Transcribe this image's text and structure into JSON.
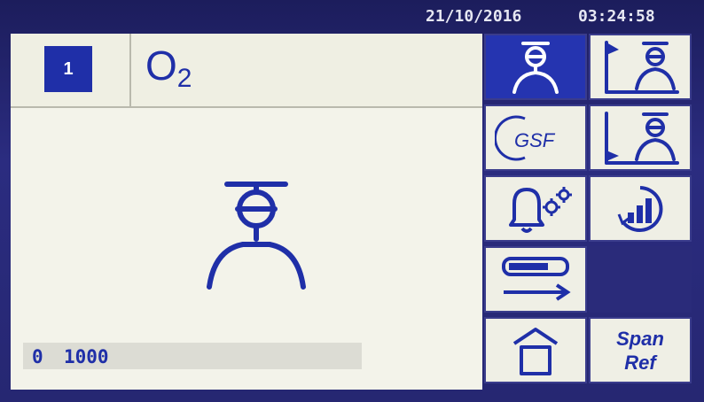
{
  "status": {
    "date": "21/10/2016",
    "time": "03:24:58"
  },
  "header": {
    "channel": "1",
    "gas_main": "O",
    "gas_sub": "2"
  },
  "main": {
    "range_min": "0",
    "range_max": "1000"
  },
  "buttons": {
    "span_ref_line1": "Span",
    "span_ref_line2": "Ref",
    "gsf_label": "GSF"
  },
  "colors": {
    "accent": "#1f2fa8",
    "panel": "#efefe5",
    "bezel": "#2a2b7a"
  },
  "icons": [
    "sensor-icon",
    "high-range-sensor-icon",
    "gsf-icon",
    "low-range-sensor-icon",
    "alarm-settings-icon",
    "history-icon",
    "progress-arrow-icon",
    "home-icon"
  ]
}
